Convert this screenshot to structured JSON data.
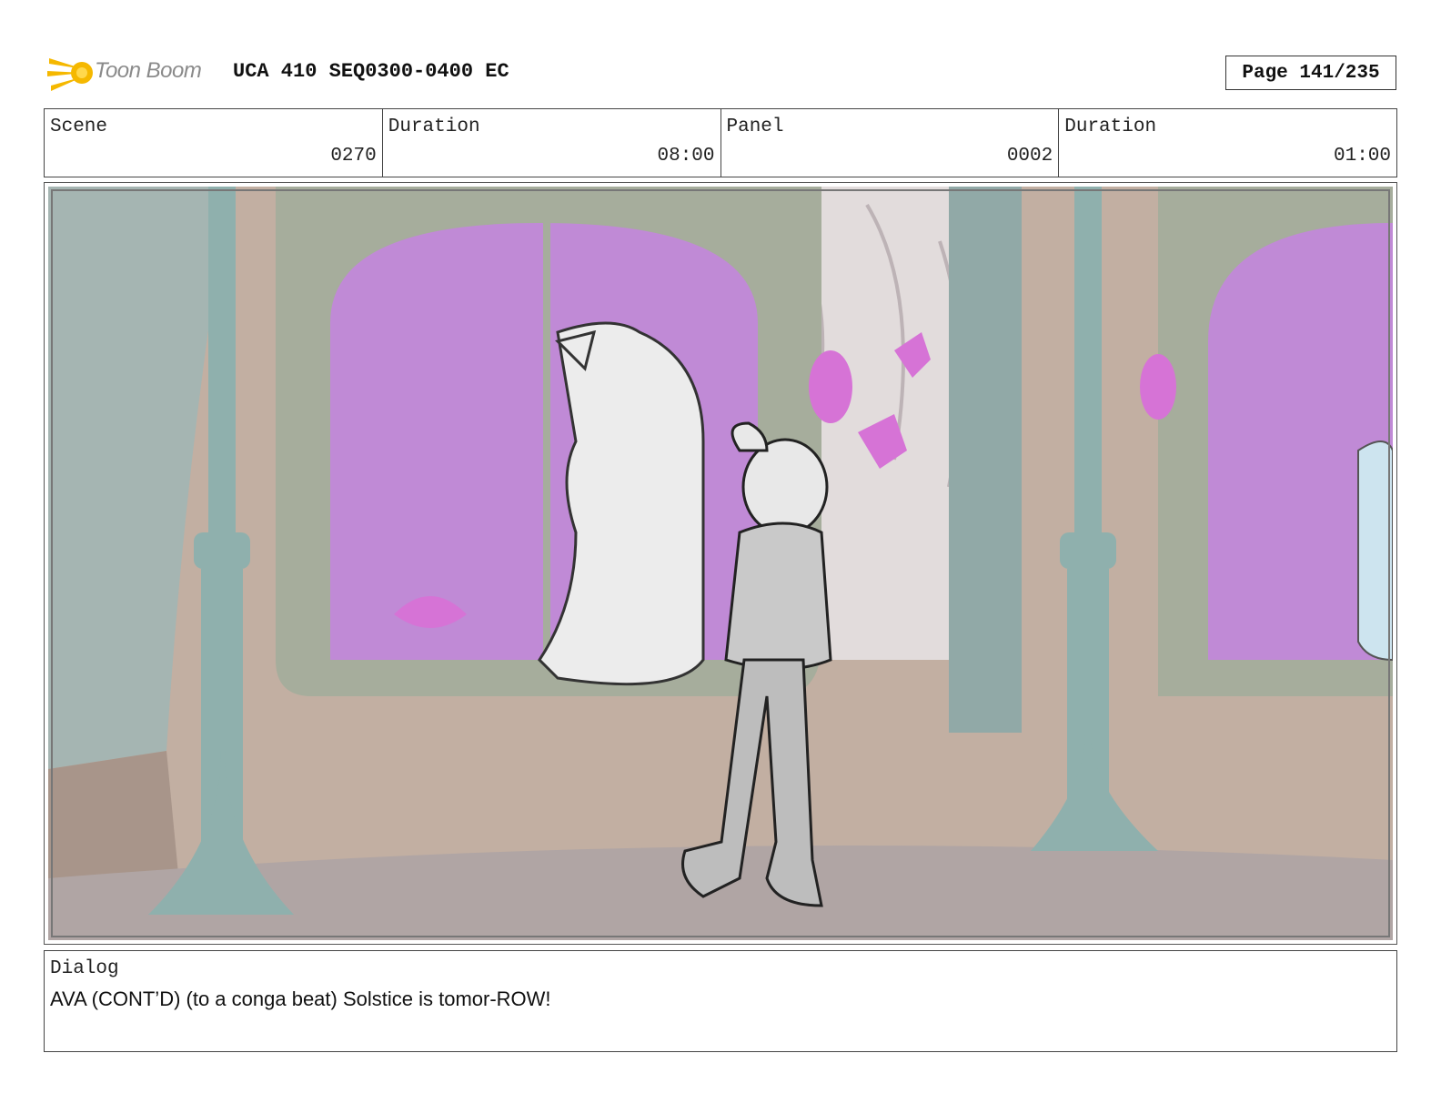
{
  "header": {
    "brand": "Toon Boom",
    "doc_title": "UCA 410 SEQ0300-0400 EC",
    "page": "Page 141/235"
  },
  "info": [
    {
      "label": "Scene",
      "value": "0270"
    },
    {
      "label": "Duration",
      "value": "08:00"
    },
    {
      "label": "Panel",
      "value": "0002"
    },
    {
      "label": "Duration",
      "value": "01:00"
    }
  ],
  "dialog": {
    "label": "Dialog",
    "text": "AVA (CONT’D) (to a conga beat) Solstice is tomor-ROW!"
  },
  "colors": {
    "accent": "#f5b800",
    "window_glass": "#c08ad6",
    "wall": "#c2afa2",
    "pillar": "#8fb0ad"
  }
}
